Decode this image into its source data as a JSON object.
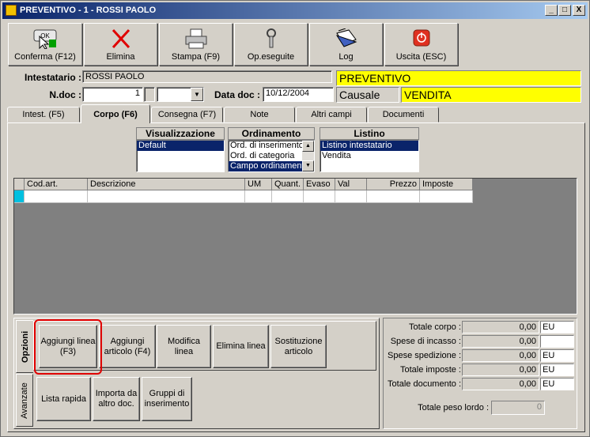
{
  "window": {
    "title": "PREVENTIVO - 1  - ROSSI PAOLO",
    "controls": [
      "_",
      "□",
      "X"
    ]
  },
  "toolbar": {
    "confirm": "Conferma (F12)",
    "confirm_icon_text": "OK",
    "delete": "Elimina",
    "print": "Stampa (F9)",
    "ops": "Op.eseguite",
    "log": "Log",
    "exit": "Uscita (ESC)"
  },
  "header": {
    "holder_label": "Intestatario :",
    "holder_value": "ROSSI PAOLO",
    "doc_type": "PREVENTIVO",
    "ndoc_label": "N.doc :",
    "ndoc_value": "1",
    "date_label": "Data doc :",
    "date_value": "10/12/2004",
    "causale_label": "Causale",
    "causale_value": "VENDITA"
  },
  "tabs": [
    "Intest. (F5)",
    "Corpo (F6)",
    "Consegna (F7)",
    "Note",
    "Altri campi",
    "Documenti"
  ],
  "visualizzazione": {
    "title": "Visualizzazione",
    "items": [
      "Default"
    ],
    "selected": 0
  },
  "ordinamento": {
    "title": "Ordinamento",
    "items": [
      "Ord. di inserimento",
      "Ord. di categoria",
      "Campo ordinamento"
    ],
    "selected": 2
  },
  "listino": {
    "title": "Listino",
    "items": [
      "Listino intestatario",
      "Vendita"
    ],
    "selected": 0
  },
  "grid": {
    "columns": [
      "Cod.art.",
      "Descrizione",
      "UM",
      "Quant.",
      "Evaso",
      "Val",
      "Prezzo",
      "Imposte"
    ]
  },
  "side_tabs": {
    "options": "Opzioni",
    "advanced": "Avanzate"
  },
  "options_buttons": {
    "add_line": "Aggiungi linea (F3)",
    "add_article": "Aggiungi articolo (F4)",
    "edit_line": "Modifica linea",
    "delete_line": "Elimina linea",
    "replace_article": "Sostituzione articolo"
  },
  "advanced_buttons": {
    "quick_list": "Lista rapida",
    "import_doc": "Importa da altro doc.",
    "insert_groups": "Gruppi di inserimento"
  },
  "totals": {
    "corpo_label": "Totale corpo :",
    "corpo_value": "0,00",
    "corpo_cur": "EU",
    "incasso_label": "Spese di incasso :",
    "incasso_value": "0,00",
    "incasso_cur": "",
    "spedizione_label": "Spese spedizione :",
    "spedizione_value": "0,00",
    "spedizione_cur": "EU",
    "imposte_label": "Totale imposte :",
    "imposte_value": "0,00",
    "imposte_cur": "EU",
    "documento_label": "Totale documento :",
    "documento_value": "0,00",
    "documento_cur": "EU",
    "peso_label": "Totale peso lordo :",
    "peso_value": "0"
  }
}
